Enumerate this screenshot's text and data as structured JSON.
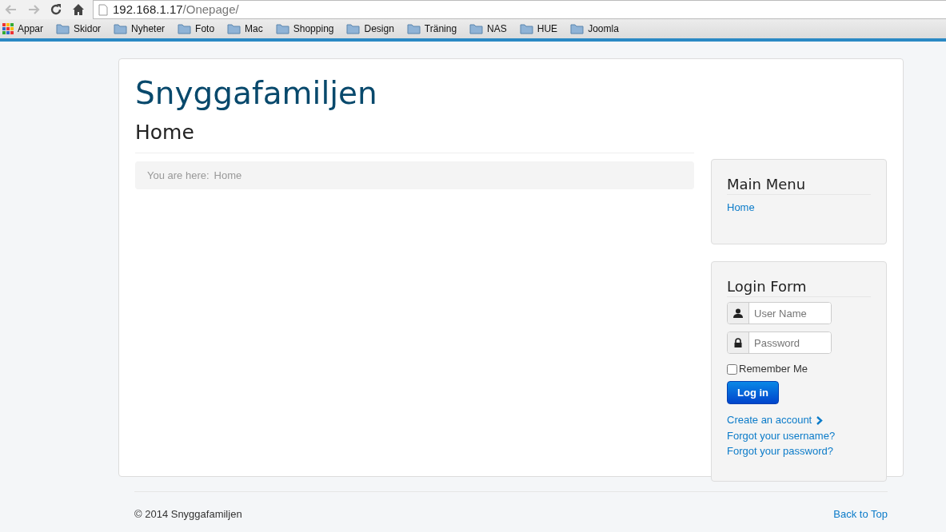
{
  "browser": {
    "url_host": "192.168.1.17",
    "url_path": "/Onepage/",
    "bookmarks": [
      {
        "label": "Appar",
        "kind": "apps"
      },
      {
        "label": "Skidor",
        "kind": "folder"
      },
      {
        "label": "Nyheter",
        "kind": "folder"
      },
      {
        "label": "Foto",
        "kind": "folder"
      },
      {
        "label": "Mac",
        "kind": "folder"
      },
      {
        "label": "Shopping",
        "kind": "folder"
      },
      {
        "label": "Design",
        "kind": "folder"
      },
      {
        "label": "Träning",
        "kind": "folder"
      },
      {
        "label": "NAS",
        "kind": "folder"
      },
      {
        "label": "HUE",
        "kind": "folder"
      },
      {
        "label": "Joomla",
        "kind": "folder"
      }
    ]
  },
  "site": {
    "title": "Snyggafamiljen",
    "page_heading": "Home",
    "breadcrumb": {
      "label": "You are here:",
      "items": [
        "Home"
      ]
    }
  },
  "main_menu": {
    "title": "Main Menu",
    "items": [
      {
        "label": "Home"
      }
    ]
  },
  "login_form": {
    "title": "Login Form",
    "username": {
      "placeholder": "User Name"
    },
    "password": {
      "placeholder": "Password"
    },
    "remember": {
      "label": "Remember Me",
      "checked": false
    },
    "button": "Log in",
    "links": [
      {
        "label": "Create an account",
        "kind": "arrow"
      },
      {
        "label": "Forgot your username?",
        "kind": "plain"
      },
      {
        "label": "Forgot your password?",
        "kind": "plain"
      }
    ]
  },
  "footer": {
    "copyright": "© 2014 Snyggafamiljen",
    "back_to_top": "Back to Top"
  }
}
